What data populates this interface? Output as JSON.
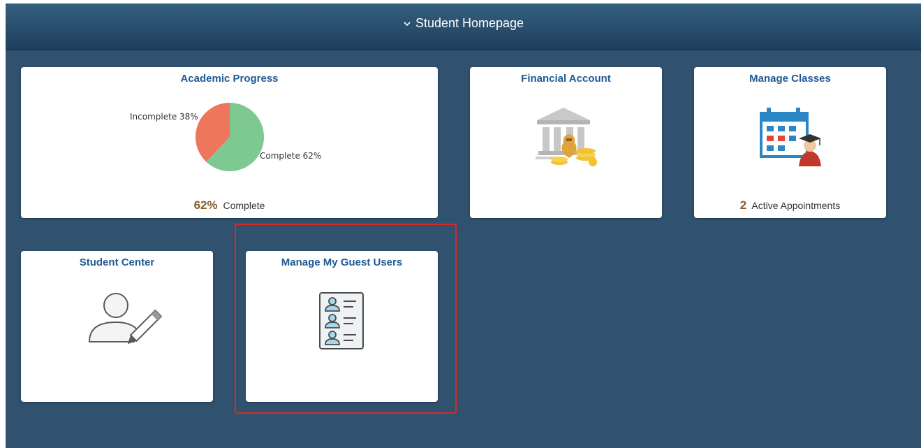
{
  "header": {
    "title": "Student Homepage"
  },
  "tiles": {
    "academic_progress": {
      "title": "Academic Progress",
      "footer_value": "62%",
      "footer_text": "Complete"
    },
    "financial_account": {
      "title": "Financial Account"
    },
    "manage_classes": {
      "title": "Manage Classes",
      "footer_value": "2",
      "footer_text": "Active Appointments"
    },
    "student_center": {
      "title": "Student Center"
    },
    "manage_guest_users": {
      "title": "Manage My Guest Users"
    }
  },
  "chart_data": {
    "type": "pie",
    "categories": [
      "Incomplete",
      "Complete"
    ],
    "values": [
      38,
      62
    ],
    "labels": [
      "Incomplete 38%",
      "Complete 62%"
    ],
    "colors": [
      "#ee765d",
      "#7ec891"
    ]
  },
  "colors": {
    "page_bg": "#30526f",
    "tile_title": "#1f5a96",
    "highlight": "#e02424"
  }
}
